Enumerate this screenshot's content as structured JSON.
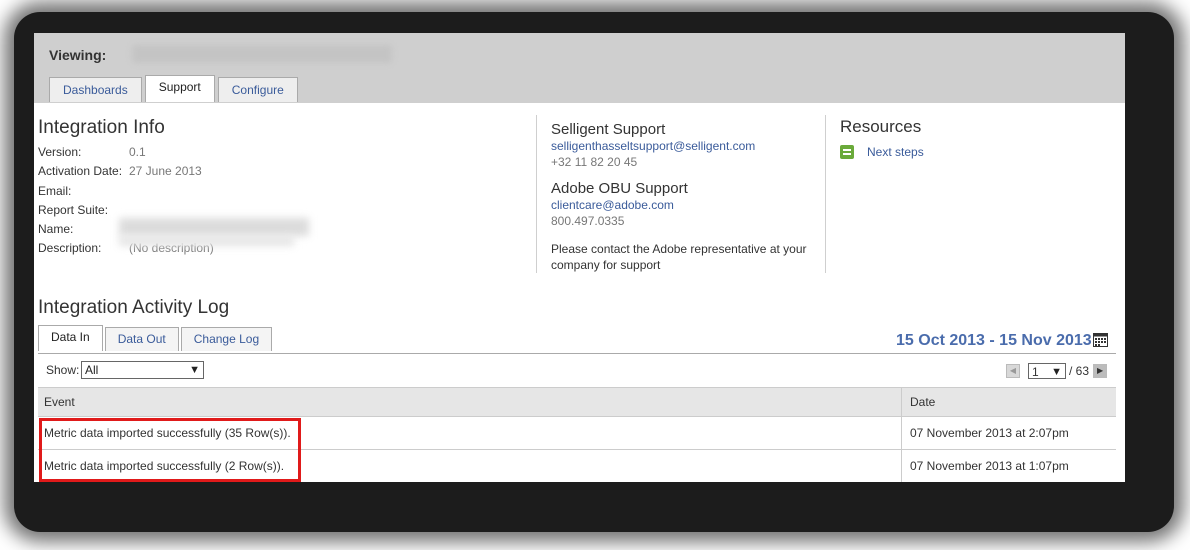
{
  "header": {
    "viewing_label": "Viewing:",
    "tabs": [
      "Dashboards",
      "Support",
      "Configure"
    ],
    "active_tab": "Support"
  },
  "integration_info": {
    "title": "Integration Info",
    "rows": [
      {
        "label": "Version:",
        "value": "0.1"
      },
      {
        "label": "Activation Date:",
        "value": "27 June 2013"
      },
      {
        "label": "Email:",
        "value": ""
      },
      {
        "label": "Report Suite:",
        "value": ""
      },
      {
        "label": "Name:",
        "value": ""
      },
      {
        "label": "Description:",
        "value": "(No description)"
      }
    ]
  },
  "support": {
    "selligent_title": "Selligent Support",
    "selligent_email": "selligenthasseltsupport@selligent.com",
    "selligent_phone": "+32 11 82 20 45",
    "adobe_title": "Adobe OBU Support",
    "adobe_email": "clientcare@adobe.com",
    "adobe_phone": "800.497.0335",
    "note": "Please contact the Adobe representative at your company for support"
  },
  "resources": {
    "title": "Resources",
    "link": "Next steps"
  },
  "activity": {
    "title": "Integration Activity Log",
    "tabs": [
      "Data In",
      "Data Out",
      "Change Log"
    ],
    "active_tab": "Data In",
    "date_range": "15 Oct 2013 - 15 Nov 2013",
    "show_label": "Show:",
    "show_value": "All",
    "page": "1",
    "page_total": "/ 63",
    "columns": [
      "Event",
      "Date"
    ],
    "rows": [
      {
        "event": "Metric data imported successfully (35 Row(s)).",
        "date": "07 November 2013 at 2:07pm"
      },
      {
        "event": "Metric data imported successfully (2 Row(s)).",
        "date": "07 November 2013 at 1:07pm"
      }
    ]
  },
  "colors": {
    "link": "#3a5b9a",
    "date_range": "#4a6cac",
    "highlight": "#e01a1a",
    "header_bg": "#cfcfcf"
  }
}
